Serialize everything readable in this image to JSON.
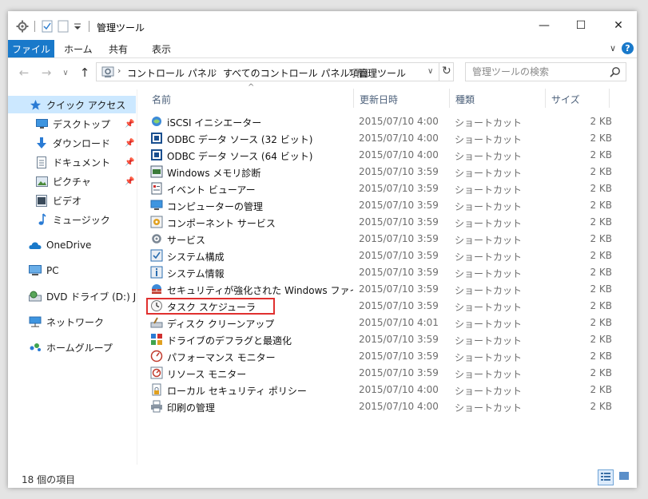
{
  "window": {
    "title": "管理ツール",
    "controls": {
      "minimize": "—",
      "maximize": "☐",
      "close": "✕"
    }
  },
  "ribbon": {
    "tabs": [
      "ファイル",
      "ホーム",
      "共有",
      "表示"
    ],
    "help": "?",
    "expand": "∨"
  },
  "nav": {
    "back": "←",
    "forward": "→",
    "recent": "∨",
    "up": "↑"
  },
  "address": {
    "crumbs": [
      "コントロール パネル",
      "すべてのコントロール パネル項目",
      "管理ツール"
    ],
    "separator": "›",
    "refresh": "↻",
    "dropdown": "∨"
  },
  "search": {
    "placeholder": "管理ツールの検索",
    "value": ""
  },
  "sidebar": {
    "items": [
      {
        "label": "クイック アクセス",
        "icon": "star-icon",
        "selected": true
      },
      {
        "label": "デスクトップ",
        "icon": "desktop-icon",
        "pinned": true
      },
      {
        "label": "ダウンロード",
        "icon": "download-icon",
        "pinned": true
      },
      {
        "label": "ドキュメント",
        "icon": "document-icon",
        "pinned": true
      },
      {
        "label": "ピクチャ",
        "icon": "pictures-icon",
        "pinned": true
      },
      {
        "label": "ビデオ",
        "icon": "video-icon"
      },
      {
        "label": "ミュージック",
        "icon": "music-icon"
      },
      {
        "label": "OneDrive",
        "icon": "onedrive-icon"
      },
      {
        "label": "PC",
        "icon": "pc-icon"
      },
      {
        "label": "DVD ドライブ (D:) J_CCS",
        "icon": "dvd-drive-icon"
      },
      {
        "label": "ネットワーク",
        "icon": "network-icon"
      },
      {
        "label": "ホームグループ",
        "icon": "homegroup-icon"
      }
    ]
  },
  "list": {
    "columns": [
      "名前",
      "更新日時",
      "種類",
      "サイズ"
    ],
    "sort_indicator": "^",
    "rows": [
      {
        "name": "iSCSI イニシエーター",
        "date": "2015/07/10 4:00",
        "type": "ショートカット",
        "size": "2 KB"
      },
      {
        "name": "ODBC データ ソース (32 ビット)",
        "date": "2015/07/10 4:00",
        "type": "ショートカット",
        "size": "2 KB"
      },
      {
        "name": "ODBC データ ソース (64 ビット)",
        "date": "2015/07/10 4:00",
        "type": "ショートカット",
        "size": "2 KB"
      },
      {
        "name": "Windows メモリ診断",
        "date": "2015/07/10 3:59",
        "type": "ショートカット",
        "size": "2 KB"
      },
      {
        "name": "イベント ビューアー",
        "date": "2015/07/10 3:59",
        "type": "ショートカット",
        "size": "2 KB"
      },
      {
        "name": "コンピューターの管理",
        "date": "2015/07/10 3:59",
        "type": "ショートカット",
        "size": "2 KB"
      },
      {
        "name": "コンポーネント サービス",
        "date": "2015/07/10 3:59",
        "type": "ショートカット",
        "size": "2 KB"
      },
      {
        "name": "サービス",
        "date": "2015/07/10 3:59",
        "type": "ショートカット",
        "size": "2 KB"
      },
      {
        "name": "システム構成",
        "date": "2015/07/10 3:59",
        "type": "ショートカット",
        "size": "2 KB"
      },
      {
        "name": "システム情報",
        "date": "2015/07/10 3:59",
        "type": "ショートカット",
        "size": "2 KB"
      },
      {
        "name": "セキュリティが強化された Windows ファイアウ...",
        "date": "2015/07/10 3:59",
        "type": "ショートカット",
        "size": "2 KB"
      },
      {
        "name": "タスク スケジューラ",
        "date": "2015/07/10 3:59",
        "type": "ショートカット",
        "size": "2 KB",
        "highlighted": true
      },
      {
        "name": "ディスク クリーンアップ",
        "date": "2015/07/10 4:01",
        "type": "ショートカット",
        "size": "2 KB"
      },
      {
        "name": "ドライブのデフラグと最適化",
        "date": "2015/07/10 3:59",
        "type": "ショートカット",
        "size": "2 KB"
      },
      {
        "name": "パフォーマンス モニター",
        "date": "2015/07/10 3:59",
        "type": "ショートカット",
        "size": "2 KB"
      },
      {
        "name": "リソース モニター",
        "date": "2015/07/10 3:59",
        "type": "ショートカット",
        "size": "2 KB"
      },
      {
        "name": "ローカル セキュリティ ポリシー",
        "date": "2015/07/10 4:00",
        "type": "ショートカット",
        "size": "2 KB"
      },
      {
        "name": "印刷の管理",
        "date": "2015/07/10 4:00",
        "type": "ショートカット",
        "size": "2 KB"
      }
    ]
  },
  "status": {
    "item_count": "18 個の項目"
  },
  "colors": {
    "accent": "#1979ca",
    "selection": "#cce8ff",
    "highlight_box": "#e0302f"
  }
}
